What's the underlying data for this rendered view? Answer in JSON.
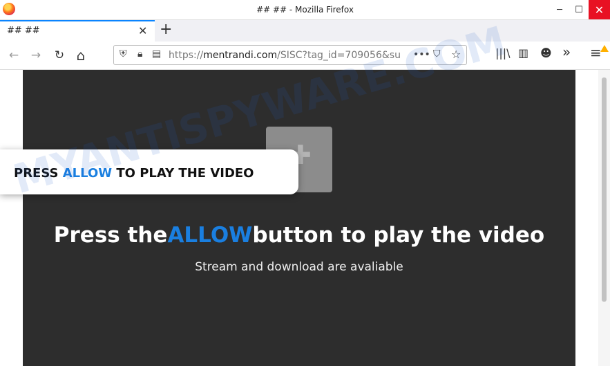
{
  "window": {
    "title": "## ## - Mozilla Firefox",
    "minimize": "─",
    "maximize": "☐",
    "close": "✕"
  },
  "tab": {
    "title": "## ##",
    "close": "✕",
    "new_tab": "+"
  },
  "toolbar": {
    "back": "←",
    "forward": "→",
    "reload": "↻",
    "home": "⌂",
    "url_prefix": "https://",
    "url_host": "mentrandi.com",
    "url_rest": "/SISC?tag_id=709056&su",
    "page_actions": "•••",
    "pocket": "⛉",
    "bookmark": "☆",
    "library": "|||\\",
    "sidebar": "▥",
    "account": "☻",
    "overflow": "»",
    "menu": "≡"
  },
  "popup": {
    "before": "PRESS ",
    "highlight": "ALLOW",
    "after": " TO PLAY THE VIDEO"
  },
  "content": {
    "headline_before": "Press the",
    "headline_highlight": "ALLOW",
    "headline_after": "button to play the video",
    "subtitle": "Stream and download are avaliable",
    "plugin_icon": "puzzle-piece"
  },
  "watermark": "MYANTISPYWARE.COM",
  "colors": {
    "accent": "#1a7fe0",
    "page_bg": "#2d2d2d",
    "close_red": "#e81123"
  }
}
